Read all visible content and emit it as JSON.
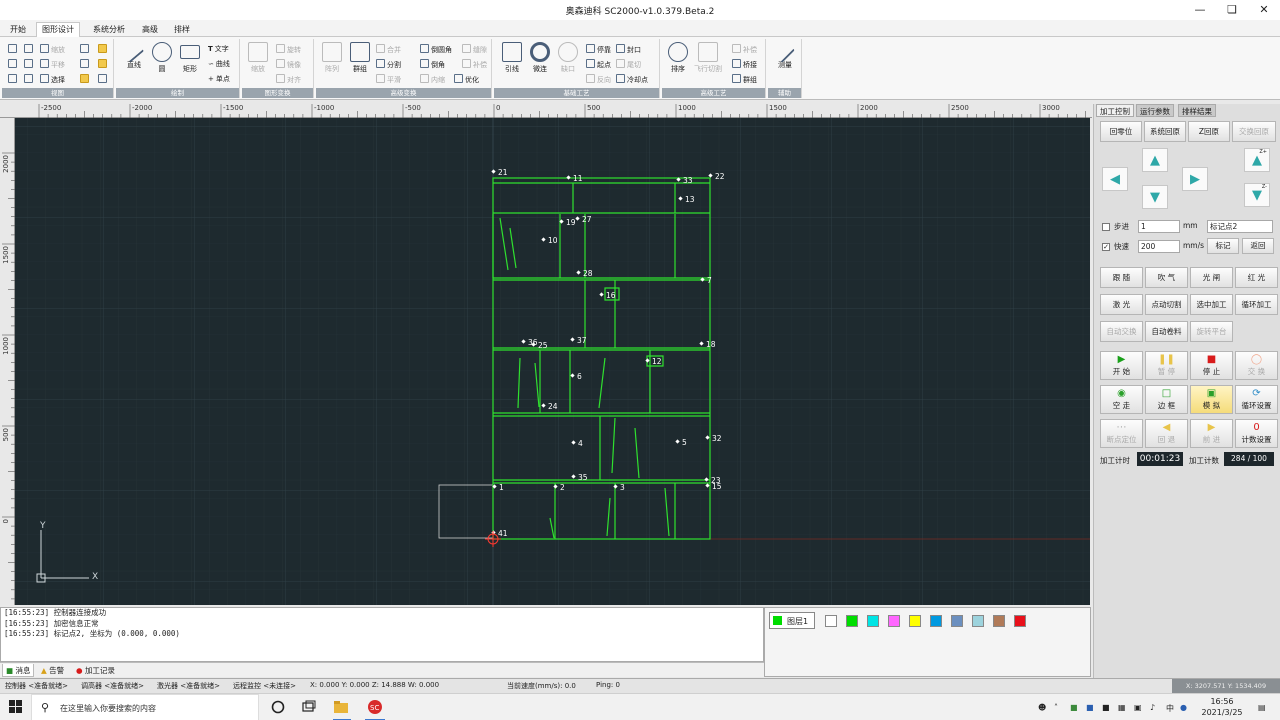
{
  "window": {
    "title": "奥森迪科  SC2000-v1.0.379.Beta.2"
  },
  "menu_tabs": [
    "开始",
    "图形设计",
    "系统分析",
    "高级",
    "排样"
  ],
  "ribbon": {
    "groups": [
      "视图",
      "绘制",
      "图形变换",
      "高级变换",
      "基础工艺",
      "高级工艺",
      "辅助"
    ],
    "view": [
      "缩放",
      "平移",
      "选择"
    ],
    "draw": {
      "line": "直线",
      "circle": "圆",
      "rect": "矩形",
      "text": "文字",
      "curve": "曲线",
      "point": "单点"
    },
    "transform": {
      "scale": "缩放",
      "rotate": "旋转",
      "mirror": "镜像",
      "align": "对齐"
    },
    "advanced": {
      "array": "阵列",
      "group": "群组",
      "merge": "合并",
      "round": "倒圆角",
      "split": "分割",
      "chamfer": "倒角",
      "smooth": "平滑",
      "shell": "内缩",
      "optimize": "优化",
      "gap": "缝隙",
      "kerf": "补偿"
    },
    "basic": {
      "lead": "引线",
      "micro": "微连",
      "loop": "缺口",
      "stop": "停靠",
      "start": "起点",
      "reverse": "反向",
      "close": "封口",
      "cool": "冷却点",
      "end": "尾切"
    },
    "advanced_process": {
      "sort": "排序",
      "fly": "飞行切割",
      "bridge": "桥接",
      "fill": "补偿",
      "sort2": "群组"
    },
    "aux": {
      "measure": "测量"
    }
  },
  "ruler": {
    "x_ticks": [
      "-2500",
      "-2000",
      "-1500",
      "-1000",
      "-500",
      "0",
      "500",
      "1000",
      "1500",
      "2000",
      "2500",
      "3000"
    ],
    "y_ticks": [
      "2000",
      "1500",
      "1000",
      "500",
      "0"
    ]
  },
  "canvas": {
    "axis_x": "X",
    "axis_y": "Y",
    "part_labels": [
      "21",
      "11",
      "33",
      "22",
      "13",
      "10",
      "19",
      "27",
      "28",
      "16",
      "7",
      "36",
      "25",
      "37",
      "18",
      "12",
      "6",
      "24",
      "4",
      "5",
      "32",
      "35",
      "2",
      "3",
      "23",
      "15",
      "1",
      "41"
    ]
  },
  "right_panel": {
    "tabs": [
      "加工控制",
      "运行参数",
      "排样结果"
    ],
    "home_buttons": [
      "回零位",
      "系统回原",
      "Z回原",
      "交换回原"
    ],
    "z_up": "Z+",
    "z_down": "Z-",
    "step_label": "步进",
    "step_value": "1",
    "step_unit": "mm",
    "mark_select": "标记点2",
    "fast_label": "快速",
    "fast_value": "200",
    "fast_unit": "mm/s",
    "mark_btn": "标记",
    "return_btn": "返回",
    "func_row1": [
      "跟 随",
      "吹 气",
      "光 闸",
      "红 光"
    ],
    "func_row2": [
      "激 光",
      "点动切割",
      "选中加工",
      "循环加工"
    ],
    "func_row3": [
      "自动交换",
      "自动卷料",
      "旋转平台"
    ],
    "ctrl_row1": [
      "开 始",
      "暂 停",
      "停 止",
      "交 换"
    ],
    "ctrl_row2": [
      "空 走",
      "边 框",
      "模 拟",
      "循环设置"
    ],
    "ctrl_row3": [
      "断点定位",
      "回 退",
      "前 进",
      "计数设置"
    ],
    "count_value": "0",
    "timer_label": "加工计时",
    "timer_value": "00:01:23",
    "count_label": "加工计数",
    "count_display": "284 / 100"
  },
  "log": {
    "lines": [
      "[16:55:23] 控制器连接成功",
      "[16:55:23] 加密信息正常",
      "[16:55:23] 标记点2, 坐标为 (0.000, 0.000)"
    ],
    "tabs": [
      "消息",
      "告警",
      "加工记录"
    ]
  },
  "layers": {
    "label": "图层1",
    "colors": [
      "#ffffff",
      "#00dd00",
      "#00e5e5",
      "#ff66ff",
      "#ffff00",
      "#0099e0",
      "#6b8fbf",
      "#9dd3dd",
      "#b07a58",
      "#e8101a"
    ]
  },
  "status": {
    "controller": "控制器 <准备就绪>",
    "height": "调高器 <准备就绪>",
    "laser": "激光器 <准备就绪>",
    "remote": "远程监控 <未连接>",
    "coords": "X: 0.000  Y: 0.000  Z: 14.888  W: 0.000",
    "speed": "当前速度(mm/s):  0.0",
    "ping": "Ping: 0",
    "cursor": "X: 3207.571 Y: 1534.409"
  },
  "taskbar": {
    "search_placeholder": "在这里输入你要搜索的内容",
    "ime": "中",
    "time": "16:56",
    "date": "2021/3/25"
  }
}
